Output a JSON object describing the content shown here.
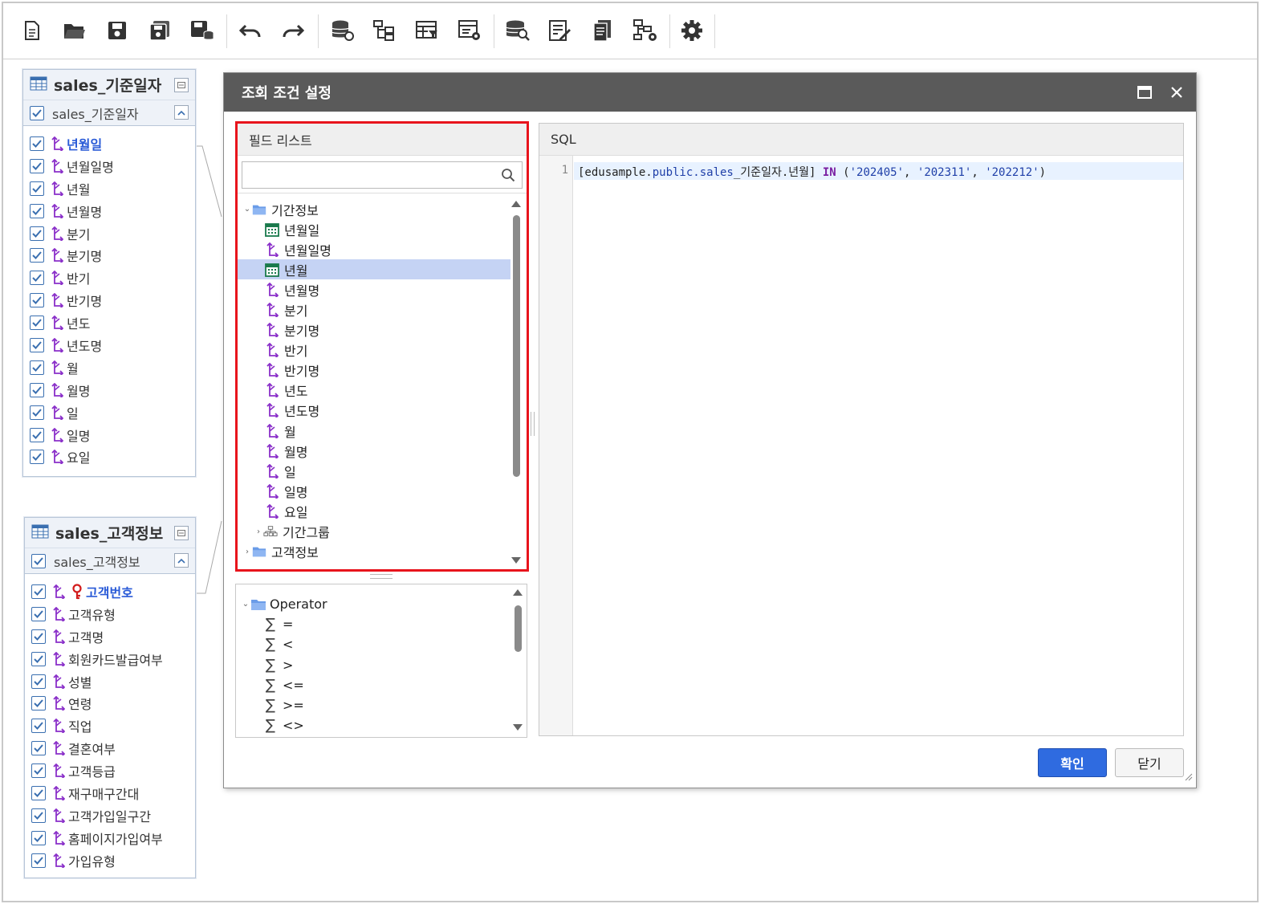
{
  "toolbar": {
    "buttons": [
      "new-document-icon",
      "open-folder-icon",
      "save-icon",
      "save-all-icon",
      "save-to-db-icon",
      "undo-icon",
      "redo-icon",
      "datasource-link-icon",
      "hierarchy-icon",
      "table-filter-icon",
      "table-settings-icon",
      "db-search-icon",
      "edit-list-icon",
      "document-copy-icon",
      "hierarchy-settings-icon",
      "gear-icon"
    ]
  },
  "entity1": {
    "title": "sales_기준일자",
    "sub_label": "sales_기준일자",
    "fields": [
      "년월일",
      "년월일명",
      "년월",
      "년월명",
      "분기",
      "분기명",
      "반기",
      "반기명",
      "년도",
      "년도명",
      "월",
      "월명",
      "일",
      "일명",
      "요일"
    ],
    "highlight_index": 0
  },
  "entity2": {
    "title": "sales_고객정보",
    "sub_label": "sales_고객정보",
    "fields": [
      "고객번호",
      "고객유형",
      "고객명",
      "회원카드발급여부",
      "성별",
      "연령",
      "직업",
      "결혼여부",
      "고객등급",
      "재구매구간대",
      "고객가입일구간",
      "홈페이지가입여부",
      "가입유형"
    ],
    "highlight_index": 0
  },
  "dialog": {
    "title": "조회 조건 설정",
    "field_list_label": "필드 리스트",
    "search_placeholder": "",
    "tree": {
      "folder_period": "기간정보",
      "period_items": [
        {
          "label": "년월일",
          "icon": "calendar-icon"
        },
        {
          "label": "년월일명",
          "icon": "dimension-icon"
        },
        {
          "label": "년월",
          "icon": "calendar-icon",
          "selected": true
        },
        {
          "label": "년월명",
          "icon": "dimension-icon"
        },
        {
          "label": "분기",
          "icon": "dimension-icon"
        },
        {
          "label": "분기명",
          "icon": "dimension-icon"
        },
        {
          "label": "반기",
          "icon": "dimension-icon"
        },
        {
          "label": "반기명",
          "icon": "dimension-icon"
        },
        {
          "label": "년도",
          "icon": "dimension-icon"
        },
        {
          "label": "년도명",
          "icon": "dimension-icon"
        },
        {
          "label": "월",
          "icon": "dimension-icon"
        },
        {
          "label": "월명",
          "icon": "dimension-icon"
        },
        {
          "label": "일",
          "icon": "dimension-icon"
        },
        {
          "label": "일명",
          "icon": "dimension-icon"
        },
        {
          "label": "요일",
          "icon": "dimension-icon"
        }
      ],
      "group_period": "기간그룹",
      "folder_customer": "고객정보"
    },
    "operator": {
      "folder": "Operator",
      "items": [
        "=",
        "<",
        ">",
        "<=",
        ">=",
        "<>"
      ]
    },
    "sql": {
      "label": "SQL",
      "line_number": "1",
      "code_prefix": "[edusample.",
      "code_schema": "public.sales",
      "code_table": "_기준일자.년월] ",
      "code_keyword": "IN",
      "code_open": " (",
      "code_values": [
        "'202405'",
        "'202311'",
        "'202212'"
      ],
      "code_close": ")"
    },
    "ok_label": "확인",
    "close_label": "닫기"
  },
  "colors": {
    "accent": "#2f6be0",
    "highlight_border": "#e8141c",
    "dimension_icon": "#8a2fc9",
    "selected_row": "#c5d3f4"
  }
}
